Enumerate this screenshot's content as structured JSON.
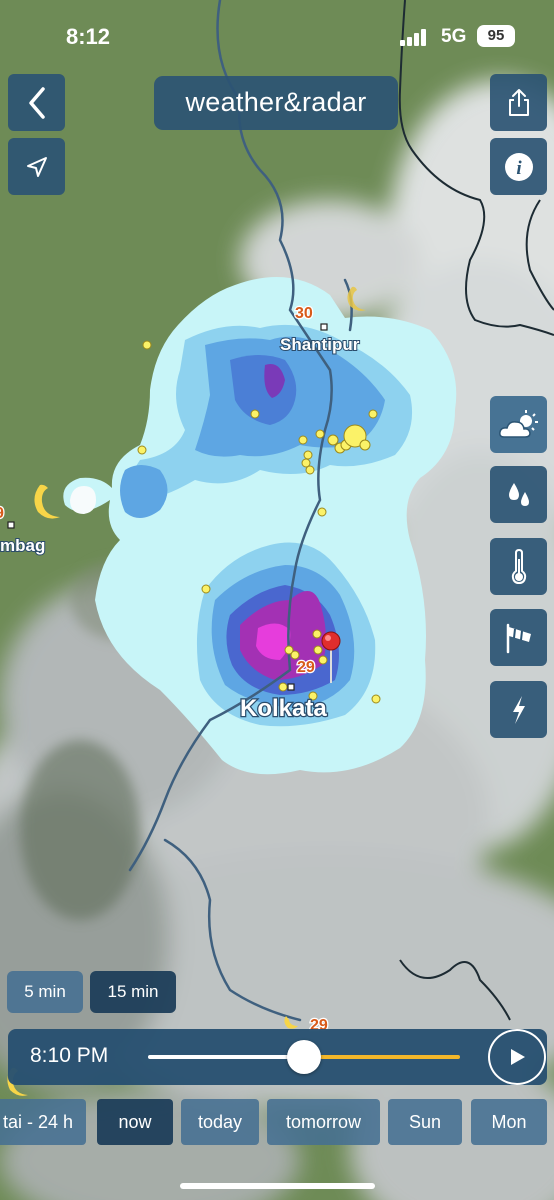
{
  "status_bar": {
    "time": "8:12",
    "network": "5G",
    "battery": "95"
  },
  "header": {
    "logo_text": "weather&radar"
  },
  "map_labels": {
    "town_top": "Shantipur",
    "town_left_fragment": "mbag",
    "city": "Kolkata",
    "temp_top": "30",
    "temp_city": "29",
    "temp_bottom": "29",
    "temp_left_fragment": "9"
  },
  "layers": [
    {
      "name": "weather-layer",
      "icon": "cloud-sun-icon"
    },
    {
      "name": "precipitation-layer",
      "icon": "drops-icon"
    },
    {
      "name": "temperature-layer",
      "icon": "thermometer-icon"
    },
    {
      "name": "wind-layer",
      "icon": "windsock-icon"
    },
    {
      "name": "lightning-layer",
      "icon": "lightning-icon"
    }
  ],
  "intervals": {
    "five": "5 min",
    "fifteen": "15 min"
  },
  "player": {
    "time": "8:10 PM",
    "progress": 0.5
  },
  "ranges": [
    "- 24 h",
    "now",
    "today",
    "tomorrow",
    "Sun",
    "Mon"
  ],
  "range_left_fragment": "tai",
  "colors": {
    "panel": "#2b5473",
    "active": "#1e3e5a",
    "accent": "#f3b72a"
  }
}
